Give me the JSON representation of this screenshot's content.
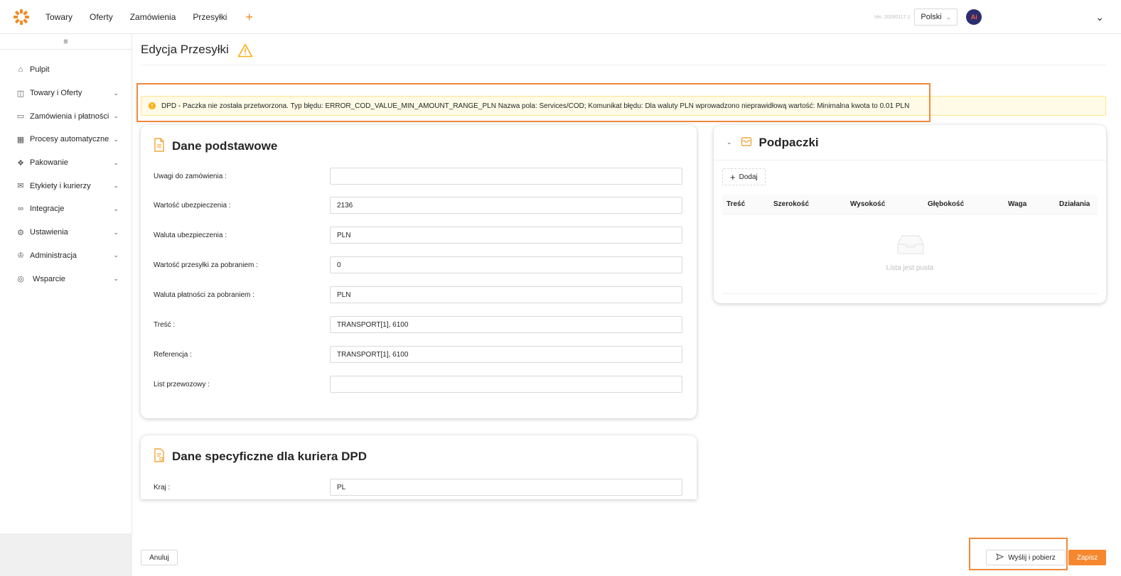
{
  "topbar": {
    "nav": [
      "Towary",
      "Oferty",
      "Zamówienia",
      "Przesyłki"
    ],
    "add": "+",
    "version": "Ver. 20260117.1",
    "language": "Polski",
    "avatar": "Ai"
  },
  "sidebar": {
    "items": [
      {
        "label": "Pulpit",
        "icon": "home-icon",
        "expandable": false
      },
      {
        "label": "Towary i Oferty",
        "icon": "bag-icon",
        "expandable": true
      },
      {
        "label": "Zamówienia i płatności",
        "icon": "folder-icon",
        "expandable": true
      },
      {
        "label": "Procesy automatyczne",
        "icon": "process-icon",
        "expandable": true
      },
      {
        "label": "Pakowanie",
        "icon": "box-icon",
        "expandable": true
      },
      {
        "label": "Etykiety i kurierzy",
        "icon": "mail-icon",
        "expandable": true
      },
      {
        "label": "Integracje",
        "icon": "link-icon",
        "expandable": true
      },
      {
        "label": "Ustawienia",
        "icon": "gear-icon",
        "expandable": true
      },
      {
        "label": "Administracja",
        "icon": "admin-icon",
        "expandable": true
      },
      {
        "label": "Wsparcie",
        "icon": "support-icon",
        "expandable": true
      }
    ]
  },
  "page": {
    "title": "Edycja Przesyłki"
  },
  "alert": {
    "text": "DPD - Paczka nie została przetworzona. Typ błędu: ERROR_COD_VALUE_MIN_AMOUNT_RANGE_PLN Nazwa pola: Services/COD; Komunikat błędu: Dla waluty PLN wprowadzono nieprawidłową wartość: Minimalna kwota to 0.01 PLN"
  },
  "basic": {
    "title": "Dane podstawowe",
    "fields": [
      {
        "label": "Uwagi do zamówienia :",
        "value": ""
      },
      {
        "label": "Wartość ubezpieczenia :",
        "value": "2136"
      },
      {
        "label": "Waluta ubezpieczenia :",
        "value": "PLN"
      },
      {
        "label": "Wartość przesyłki za pobraniem :",
        "value": "0"
      },
      {
        "label": "Waluta płatności za pobraniem :",
        "value": "PLN"
      },
      {
        "label": "Treść :",
        "value": "TRANSPORT[1], 6100"
      },
      {
        "label": "Referencja :",
        "value": "TRANSPORT[1], 6100"
      },
      {
        "label": "List przewozowy :",
        "value": ""
      }
    ]
  },
  "dpd": {
    "title": "Dane specyficzne dla kuriera DPD",
    "fields": [
      {
        "label": "Kraj :",
        "value": "PL"
      }
    ]
  },
  "packages": {
    "title": "Podpaczki",
    "add_label": "Dodaj",
    "columns": [
      "Treść",
      "Szerokość",
      "Wysokość",
      "Głębokość",
      "Waga",
      "Działania"
    ],
    "empty_text": "Lista jest pusta"
  },
  "footer": {
    "cancel": "Anuluj",
    "send": "Wyślij i pobierz",
    "save": "Zapisz"
  },
  "colors": {
    "accent": "#f7872e",
    "highlight": "#f0883e",
    "warning": "#faad14"
  }
}
